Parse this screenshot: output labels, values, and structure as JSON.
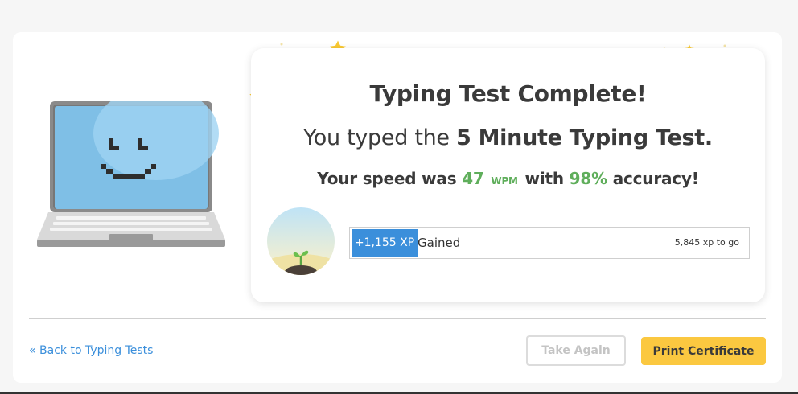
{
  "result": {
    "title": "Typing Test Complete!",
    "subtitle_prefix": "You typed the",
    "test_name": "5 Minute Typing Test.",
    "speed_prefix": "Your speed was",
    "wpm_value": "47",
    "wpm_unit": "WPM",
    "speed_middle": "with",
    "accuracy_value": "98%",
    "accuracy_suffix": "accuracy!"
  },
  "xp": {
    "gained_amount": "+1,155 XP",
    "gained_label": "Gained",
    "to_go": "5,845 xp to go"
  },
  "footer": {
    "back_link": "« Back to Typing Tests",
    "take_again": "Take Again",
    "print_certificate": "Print Certificate"
  },
  "colors": {
    "accent_blue": "#3b8fdb",
    "accent_green": "#5fae5b",
    "button_yellow": "#fbc840",
    "star_gold": "#f9c932"
  },
  "icons": [
    "laptop-smiley-icon",
    "star-icon",
    "sprout-avatar-icon"
  ]
}
